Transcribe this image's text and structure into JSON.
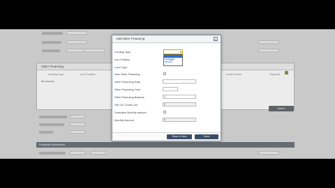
{
  "background": {
    "panel": {
      "title": "Other Financing",
      "col_a": "Lending Type",
      "col_b": "Lien Position",
      "col_c": "Lender Name",
      "col_d": "Payment",
      "row_text": "No records"
    },
    "delete_label": "Delete",
    "section_label": "Financial Information"
  },
  "dialog": {
    "title": "Add Other Financing",
    "close_glyph": "x",
    "fields": {
      "lending_type": "Lending Type",
      "lien_position": "Lien Position",
      "loan_type": "Loan Type",
      "new_other_financing": "New Other Financing",
      "other_financing_rate": "Other Financing Rate",
      "other_financing_term": "Other Financing Term",
      "other_financing_balance": "Other Financing Balance",
      "heloc_credit_line": "HELOC Credit Line",
      "subsidize_monthly_amount": "Subsidize Monthly amount",
      "monthly_amount": "Monthly Amount"
    },
    "values": {
      "lending_type": "",
      "other_financing_balance": "0",
      "heloc_credit_line": "0",
      "monthly_amount": "0"
    },
    "dropdown": {
      "arrow": "▾",
      "options": [
        "",
        "Mortgage",
        "HELOC"
      ],
      "selected_index": 0
    },
    "save_new_label": "Save & New",
    "save_label": "Save"
  },
  "colors": {
    "accent": "#3a4d66",
    "highlight": "#2f6fd6",
    "focus_border": "#c9a100"
  }
}
